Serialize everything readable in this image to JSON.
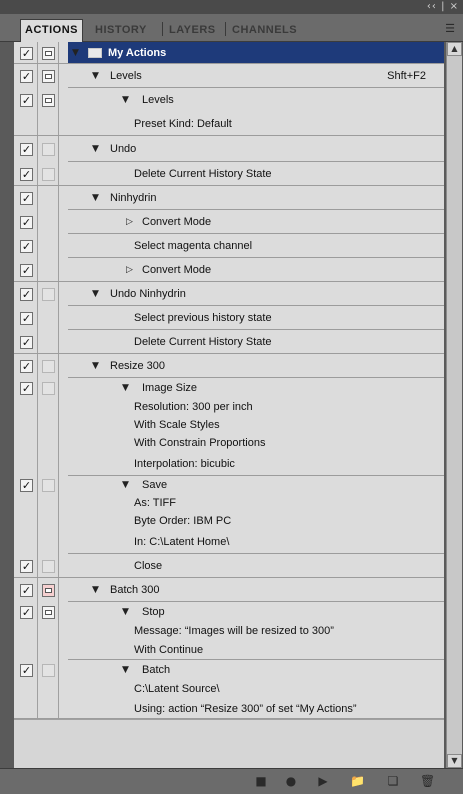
{
  "window": {
    "controls": "‹‹ | ×"
  },
  "tabs": [
    "ACTIONS",
    "HISTORY",
    "LAYERS",
    "CHANNELS"
  ],
  "active_tab": "ACTIONS",
  "set_title": "My Actions",
  "rows": [
    {
      "kind": "action",
      "text": "Levels",
      "shortcut": "Shft+F2"
    },
    {
      "kind": "step",
      "text": "Levels"
    },
    {
      "kind": "detail",
      "text": "Preset Kind: Default"
    },
    {
      "kind": "action",
      "text": "Undo"
    },
    {
      "kind": "step",
      "text": "Delete Current History State"
    },
    {
      "kind": "action",
      "text": "Ninhydrin"
    },
    {
      "kind": "step",
      "text": "Convert Mode"
    },
    {
      "kind": "step",
      "text": "Select magenta channel"
    },
    {
      "kind": "step",
      "text": "Convert Mode"
    },
    {
      "kind": "action",
      "text": "Undo Ninhydrin"
    },
    {
      "kind": "step",
      "text": "Select previous history state"
    },
    {
      "kind": "step",
      "text": "Delete Current History State"
    },
    {
      "kind": "action",
      "text": "Resize 300"
    },
    {
      "kind": "step",
      "text": "Image Size"
    },
    {
      "kind": "detail",
      "text": "Resolution: 300 per inch"
    },
    {
      "kind": "detail",
      "text": "With Scale Styles"
    },
    {
      "kind": "detail",
      "text": "With Constrain Proportions"
    },
    {
      "kind": "detail",
      "text": "Interpolation: bicubic"
    },
    {
      "kind": "step",
      "text": "Save"
    },
    {
      "kind": "detail",
      "text": "As: TIFF"
    },
    {
      "kind": "detail",
      "text": "Byte Order: IBM PC"
    },
    {
      "kind": "detail",
      "text": "In: C:\\Latent Home\\"
    },
    {
      "kind": "step",
      "text": "Close"
    },
    {
      "kind": "action",
      "text": "Batch 300"
    },
    {
      "kind": "step",
      "text": "Stop"
    },
    {
      "kind": "detail",
      "text": "Message:  “Images will be resized to 300”"
    },
    {
      "kind": "detail",
      "text": "With Continue"
    },
    {
      "kind": "step",
      "text": "Batch"
    },
    {
      "kind": "detail",
      "text": "C:\\Latent Source\\"
    },
    {
      "kind": "detail",
      "text": "Using: action “Resize 300” of set “My Actions”"
    }
  ],
  "toolbar": [
    "stop-icon",
    "record-icon",
    "play-icon",
    "new-set-icon",
    "new-action-icon",
    "delete-icon"
  ]
}
